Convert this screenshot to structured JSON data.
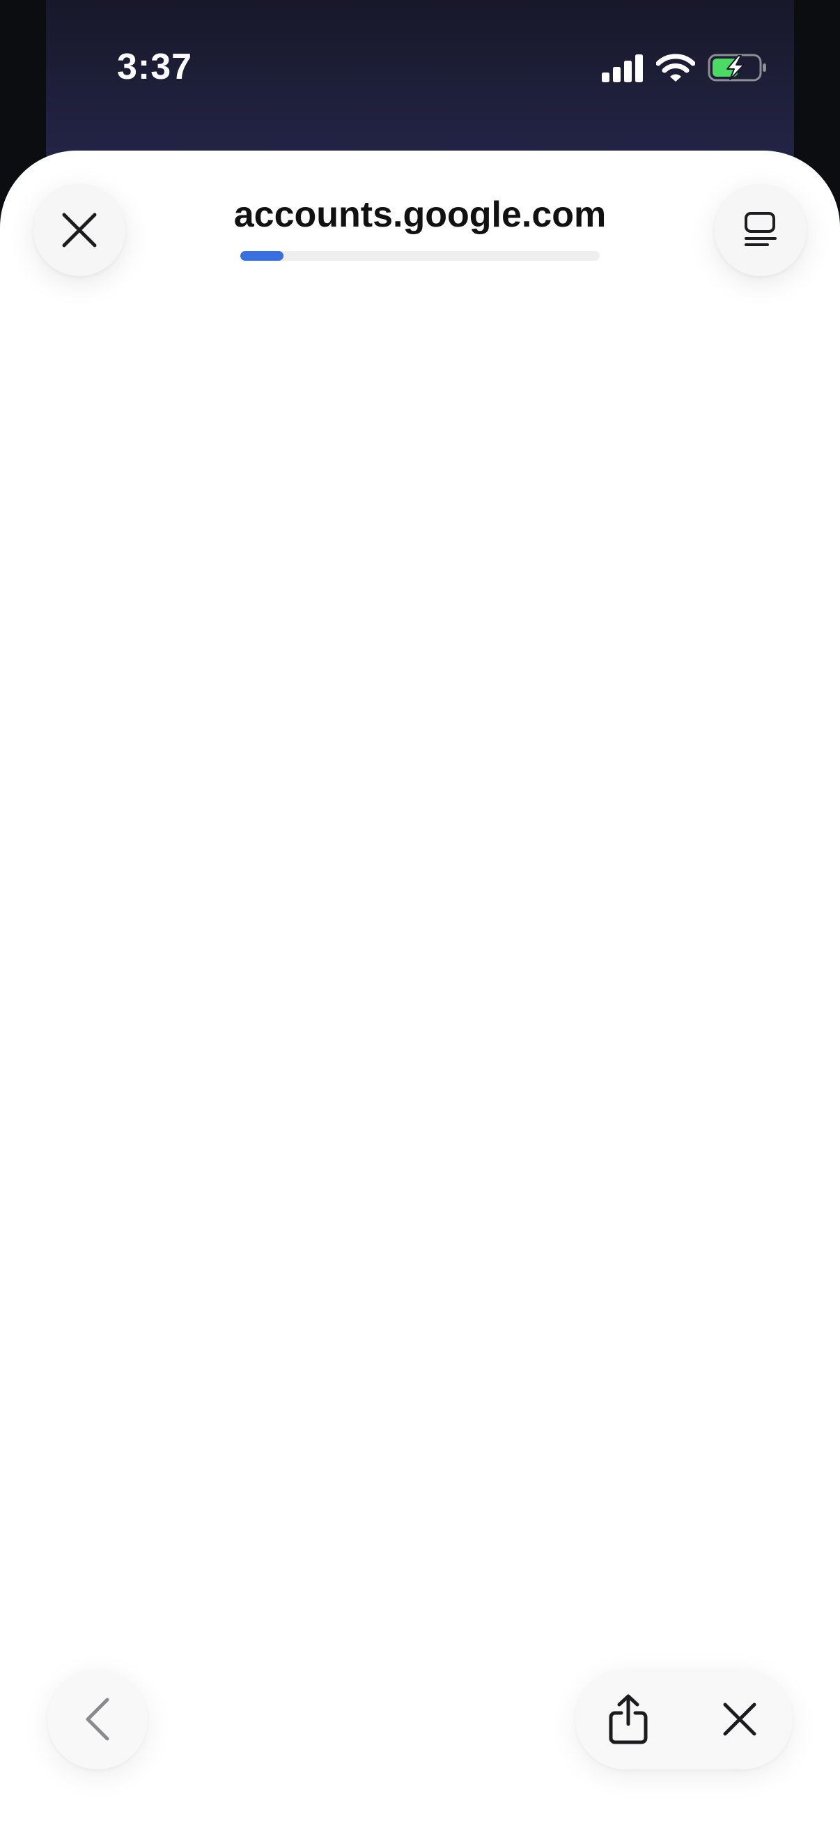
{
  "status_bar": {
    "time": "3:37",
    "icons": [
      "cellular-signal-icon",
      "wifi-icon",
      "battery-charging-icon"
    ],
    "battery_color": "#4cd964"
  },
  "browser": {
    "url": "accounts.google.com",
    "load_progress": 0.12,
    "progress_color": "#3a6fe0",
    "top_controls": {
      "close_icon": "close-icon",
      "reader_icon": "reader-mode-icon"
    },
    "bottom_controls": {
      "back_icon": "chevron-left-icon",
      "share_icon": "share-icon",
      "close_icon": "close-icon"
    }
  }
}
